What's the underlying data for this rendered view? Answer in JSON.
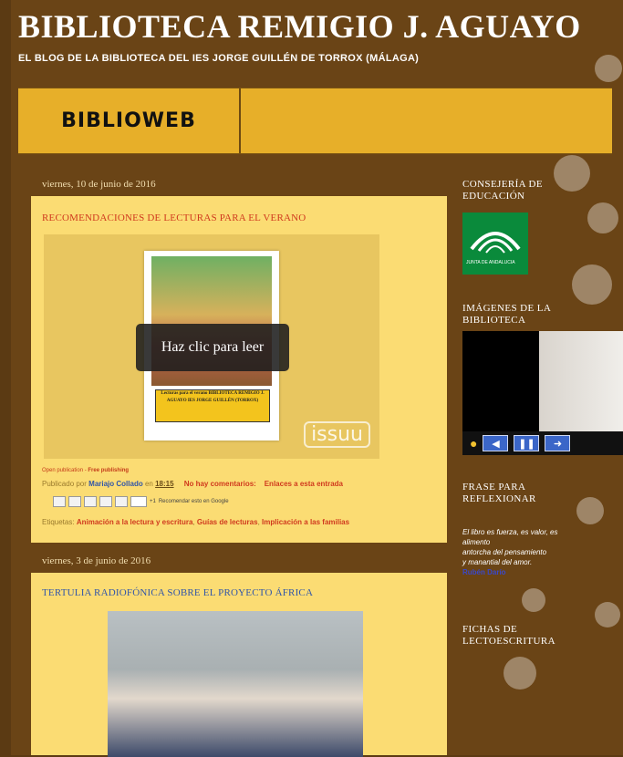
{
  "blog": {
    "title": "BIBLIOTECA REMIGIO J. AGUAYO",
    "description": "EL BLOG DE LA BIBLIOTECA DEL IES JORGE GUILLÉN DE TORROX (MÁLAGA)"
  },
  "tabs": [
    "BIBLIOWEB"
  ],
  "posts": [
    {
      "date": "viernes, 10 de junio de 2016",
      "title": "RECOMENDACIONES DE LECTURAS PARA EL VERANO",
      "embed_button": "Haz clic para leer",
      "embed_brand": "issuu",
      "cover_caption": "Lecturas para el verano BIBLIOTECA REMIGIO J. AGUAYO IES JORGE GUILLÉN (TORROX)",
      "open_pub": "Open publication",
      "free_pub": "Free publishing",
      "published_by": "Publicado por",
      "author": "Mariajo Collado",
      "at": "en",
      "time": "18:15",
      "comments": "No hay comentarios:",
      "links": "Enlaces a esta entrada",
      "share_count": "+1",
      "recommend": "Recomendar esto en Google",
      "labels_prefix": "Etiquetas:",
      "labels": [
        "Animación a la lectura y escritura",
        "Guías de lecturas",
        "Implicación a las familias"
      ]
    },
    {
      "date": "viernes, 3 de junio de 2016",
      "title": "TERTULIA RADIOFÓNICA SOBRE EL PROYECTO ÁFRICA"
    }
  ],
  "sidebar": {
    "consejeria": "CONSEJERÍA DE EDUCACIÓN",
    "junta_label": "JUNTA DE ANDALUCIA",
    "imagenes": "IMÁGENES DE LA BIBLIOTECA",
    "frase": "FRASE PARA REFLEXIONAR",
    "quote_lines": [
      "El libro es fuerza, es valor, es",
      "alimento",
      "antorcha del pensamiento",
      "y manantial del amor."
    ],
    "quote_author": "Rubén Darío",
    "fichas": "FICHAS DE LECTOESCRITURA"
  },
  "colors": {
    "background": "#6a4416",
    "post_bg": "#fbdc73",
    "tab_bg": "#e7af29",
    "title_red": "#d03a1e",
    "title_blue": "#3256a8"
  }
}
